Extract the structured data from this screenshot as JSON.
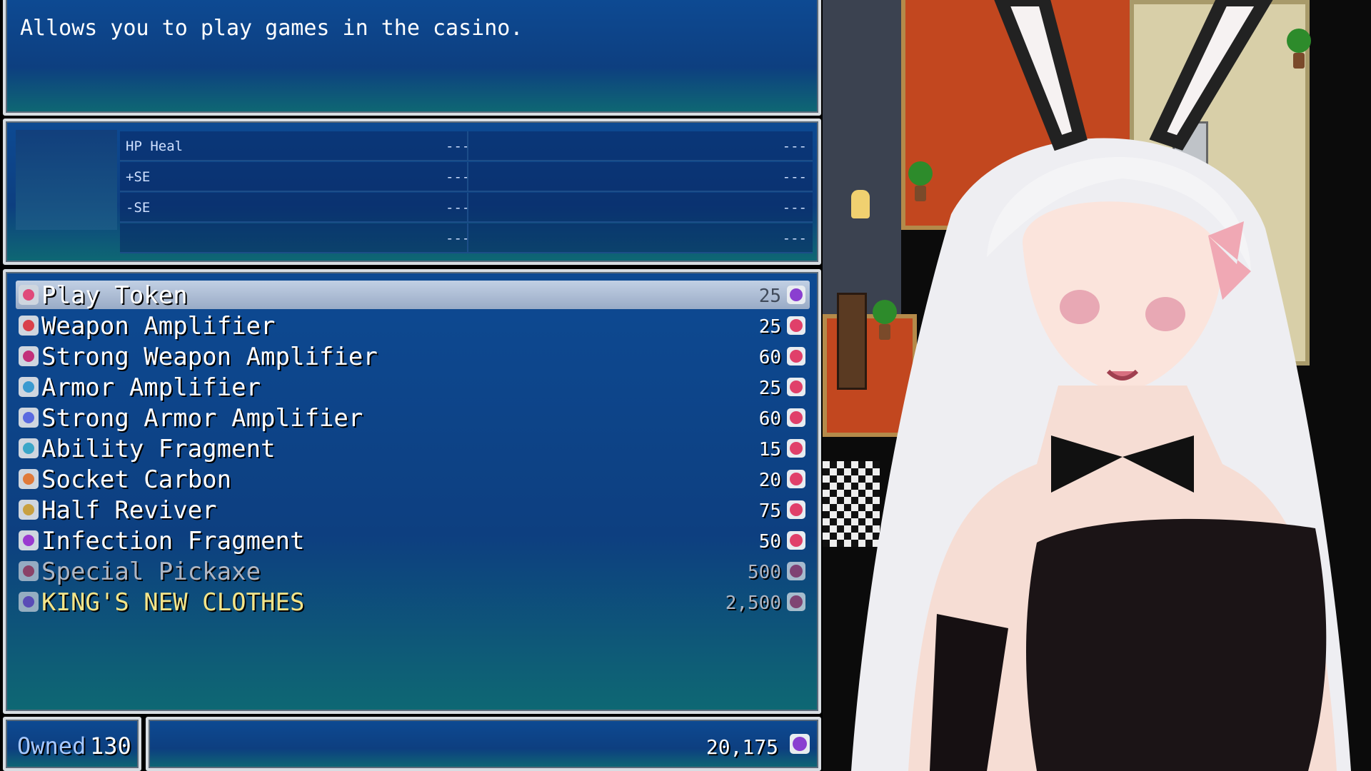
{
  "help": {
    "text": "Allows you to play games in the casino."
  },
  "status": {
    "rows": [
      {
        "label": "HP Heal",
        "v1": "---",
        "v2": "---"
      },
      {
        "label": "+SE",
        "v1": "---",
        "v2": "---"
      },
      {
        "label": "-SE",
        "v1": "---",
        "v2": "---"
      },
      {
        "label": "",
        "v1": "---",
        "v2": "---"
      }
    ]
  },
  "shop": {
    "items": [
      {
        "name": "Play Token",
        "price": "25",
        "icon": "play-token-icon",
        "icon_color": "#e04a7a",
        "currency_color": "#8a3fd0"
      },
      {
        "name": "Weapon Amplifier",
        "price": "25",
        "icon": "weapon-amplifier-icon",
        "icon_color": "#d9404a",
        "currency_color": "#e0406a"
      },
      {
        "name": "Strong Weapon Amplifier",
        "price": "60",
        "icon": "strong-weapon-amplifier-icon",
        "icon_color": "#c2307a",
        "currency_color": "#e0406a"
      },
      {
        "name": "Armor Amplifier",
        "price": "25",
        "icon": "armor-amplifier-icon",
        "icon_color": "#3a9ad0",
        "currency_color": "#e0406a"
      },
      {
        "name": "Strong Armor Amplifier",
        "price": "60",
        "icon": "strong-armor-amplifier-icon",
        "icon_color": "#5a6ae0",
        "currency_color": "#e0406a"
      },
      {
        "name": "Ability Fragment",
        "price": "15",
        "icon": "ability-fragment-icon",
        "icon_color": "#3aa6c8",
        "currency_color": "#e0406a"
      },
      {
        "name": "Socket Carbon",
        "price": "20",
        "icon": "socket-carbon-icon",
        "icon_color": "#e07a3a",
        "currency_color": "#e0406a"
      },
      {
        "name": "Half Reviver",
        "price": "75",
        "icon": "half-reviver-icon",
        "icon_color": "#c8a040",
        "currency_color": "#e0406a"
      },
      {
        "name": "Infection Fragment",
        "price": "50",
        "icon": "infection-fragment-icon",
        "icon_color": "#9a3ad0",
        "currency_color": "#e0406a"
      },
      {
        "name": "Special Pickaxe",
        "price": "500",
        "icon": "special-pickaxe-icon",
        "icon_color": "#c04060",
        "currency_color": "#b04070"
      },
      {
        "name": "KING'S NEW CLOTHES",
        "price": "2,500",
        "icon": "kings-new-clothes-icon",
        "icon_color": "#7a4ad0",
        "currency_color": "#b04070"
      }
    ]
  },
  "owned": {
    "label": "Owned",
    "value": "130"
  },
  "gold": {
    "value": "20,175",
    "icon": "token-currency-icon"
  }
}
